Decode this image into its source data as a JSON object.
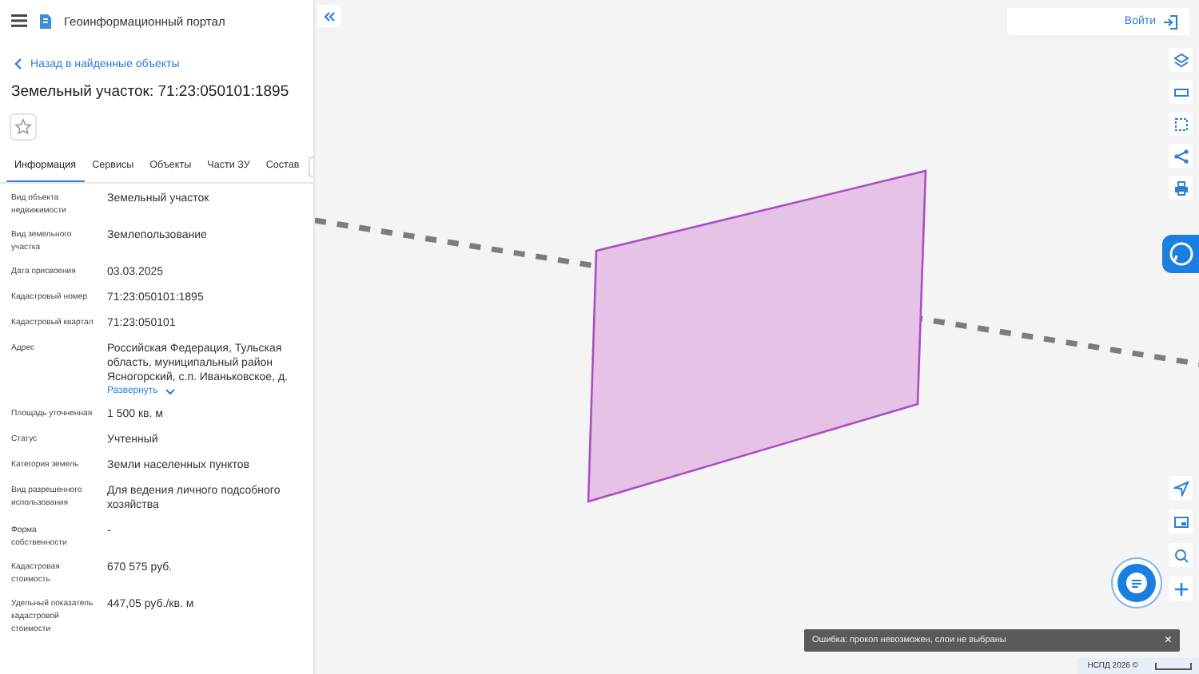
{
  "header": {
    "title": "Геоинформационный портал"
  },
  "back_link": "Назад в найденные объекты",
  "object_title": "Земельный участок: 71:23:050101:1895",
  "favorite": {
    "selected": false
  },
  "tabs": [
    {
      "label": "Информация",
      "selected": true
    },
    {
      "label": "Сервисы",
      "selected": false
    },
    {
      "label": "Объекты",
      "selected": false
    },
    {
      "label": "Части ЗУ",
      "selected": false
    },
    {
      "label": "Состав",
      "selected": false
    }
  ],
  "fields": [
    {
      "label": "Вид объекта недвижимости",
      "value": "Земельный участок"
    },
    {
      "label": "Вид земельного участка",
      "value": "Землепользование"
    },
    {
      "label": "Дата присвоения",
      "value": "03.03.2025"
    },
    {
      "label": "Кадастровый номер",
      "value": "71:23:050101:1895"
    },
    {
      "label": "Кадастровый квартал",
      "value": "71:23:050101"
    },
    {
      "label": "Адрес",
      "value": "Российская Федерация, Тульская область, муниципальный район Ясногорский, с.п. Иваньковское, д.",
      "expand_link": "Развернуть"
    },
    {
      "label": "Площадь уточненная",
      "value": "1 500 кв. м"
    },
    {
      "label": "Статус",
      "value": "Учтенный"
    },
    {
      "label": "Категория земель",
      "value": "Земли населенных пунктов"
    },
    {
      "label": "Вид разрешенного использования",
      "value": "Для ведения личного подсобного хозяйства"
    },
    {
      "label": "Форма собственности",
      "value": "-"
    },
    {
      "label": "Кадастровая стоимость",
      "value": "670 575 руб."
    },
    {
      "label": "Удельный показатель кадастровой стоимости",
      "value": "447,05 руб./кв. м"
    }
  ],
  "login_button": "Войти",
  "toast": {
    "message": "Ошибка: прокол невозможен, слои не выбраны",
    "close": "×"
  },
  "attribution": "НСПД 2026 ©"
}
